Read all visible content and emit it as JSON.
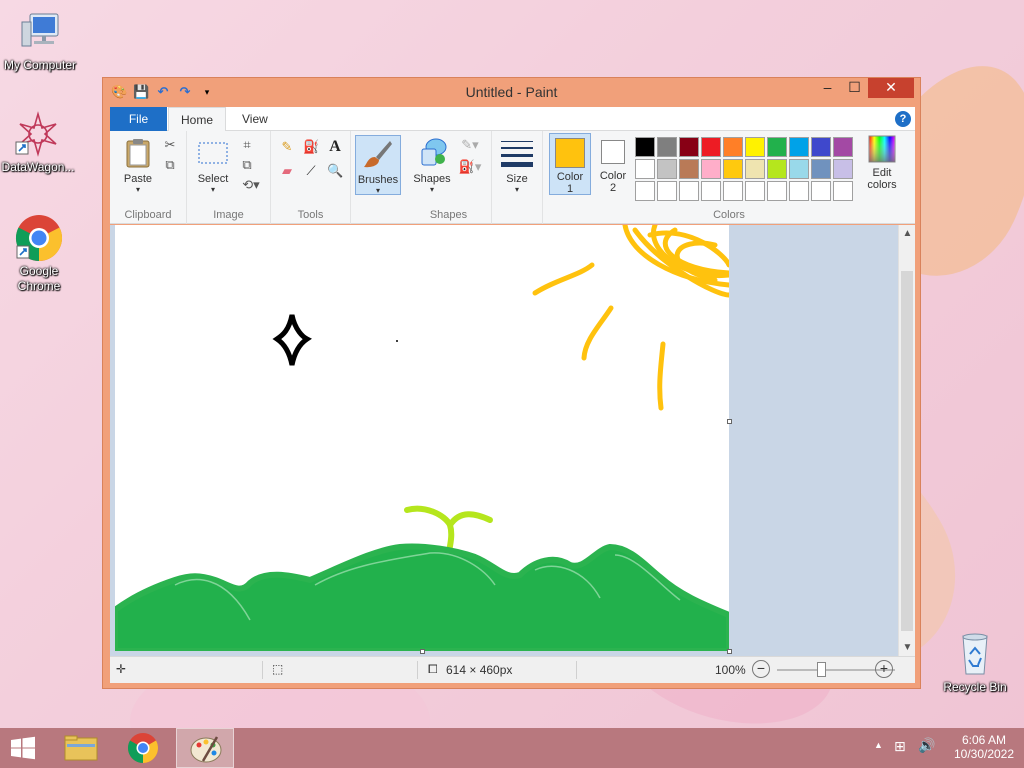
{
  "desktop": {
    "icons": [
      {
        "label": "My Computer"
      },
      {
        "label": "DataWagon..."
      },
      {
        "label": "Google Chrome"
      },
      {
        "label": "Recycle Bin"
      }
    ]
  },
  "window": {
    "title": "Untitled - Paint",
    "controls": {
      "minimize": "‒",
      "maximize": "☐",
      "close": "✕"
    }
  },
  "ribbon": {
    "tabs": {
      "file": "File",
      "home": "Home",
      "view": "View"
    },
    "help": "?",
    "clipboard": {
      "paste": "Paste",
      "label": "Clipboard"
    },
    "image": {
      "select": "Select",
      "label": "Image"
    },
    "tools": {
      "label": "Tools"
    },
    "brushes": {
      "label": "Brushes"
    },
    "shapes": {
      "shapes": "Shapes",
      "label": "Shapes"
    },
    "size": {
      "label": "Size"
    },
    "colors": {
      "color1": "Color",
      "color1_num": "1",
      "color2": "Color",
      "color2_num": "2",
      "edit": "Edit",
      "edit2": "colors",
      "label": "Colors",
      "color1_value": "#ffc20e",
      "color2_value": "#ffffff",
      "palette_row1": [
        "#000000",
        "#7f7f7f",
        "#880015",
        "#ed1c24",
        "#ff7f27",
        "#fff200",
        "#22b14c",
        "#00a2e8",
        "#3f48cc",
        "#a349a4"
      ],
      "palette_row2": [
        "#ffffff",
        "#c3c3c3",
        "#b97a57",
        "#ffaec9",
        "#ffc90e",
        "#efe4b0",
        "#b5e61d",
        "#99d9ea",
        "#7092be",
        "#c8bfe7"
      ],
      "palette_row3": [
        "#ffffff",
        "#ffffff",
        "#ffffff",
        "#ffffff",
        "#ffffff",
        "#ffffff",
        "#ffffff",
        "#ffffff",
        "#ffffff",
        "#ffffff"
      ]
    }
  },
  "status": {
    "dimensions": "614 × 460px",
    "zoom": "100%"
  },
  "taskbar": {
    "time": "6:06 AM",
    "date": "10/30/2022"
  }
}
